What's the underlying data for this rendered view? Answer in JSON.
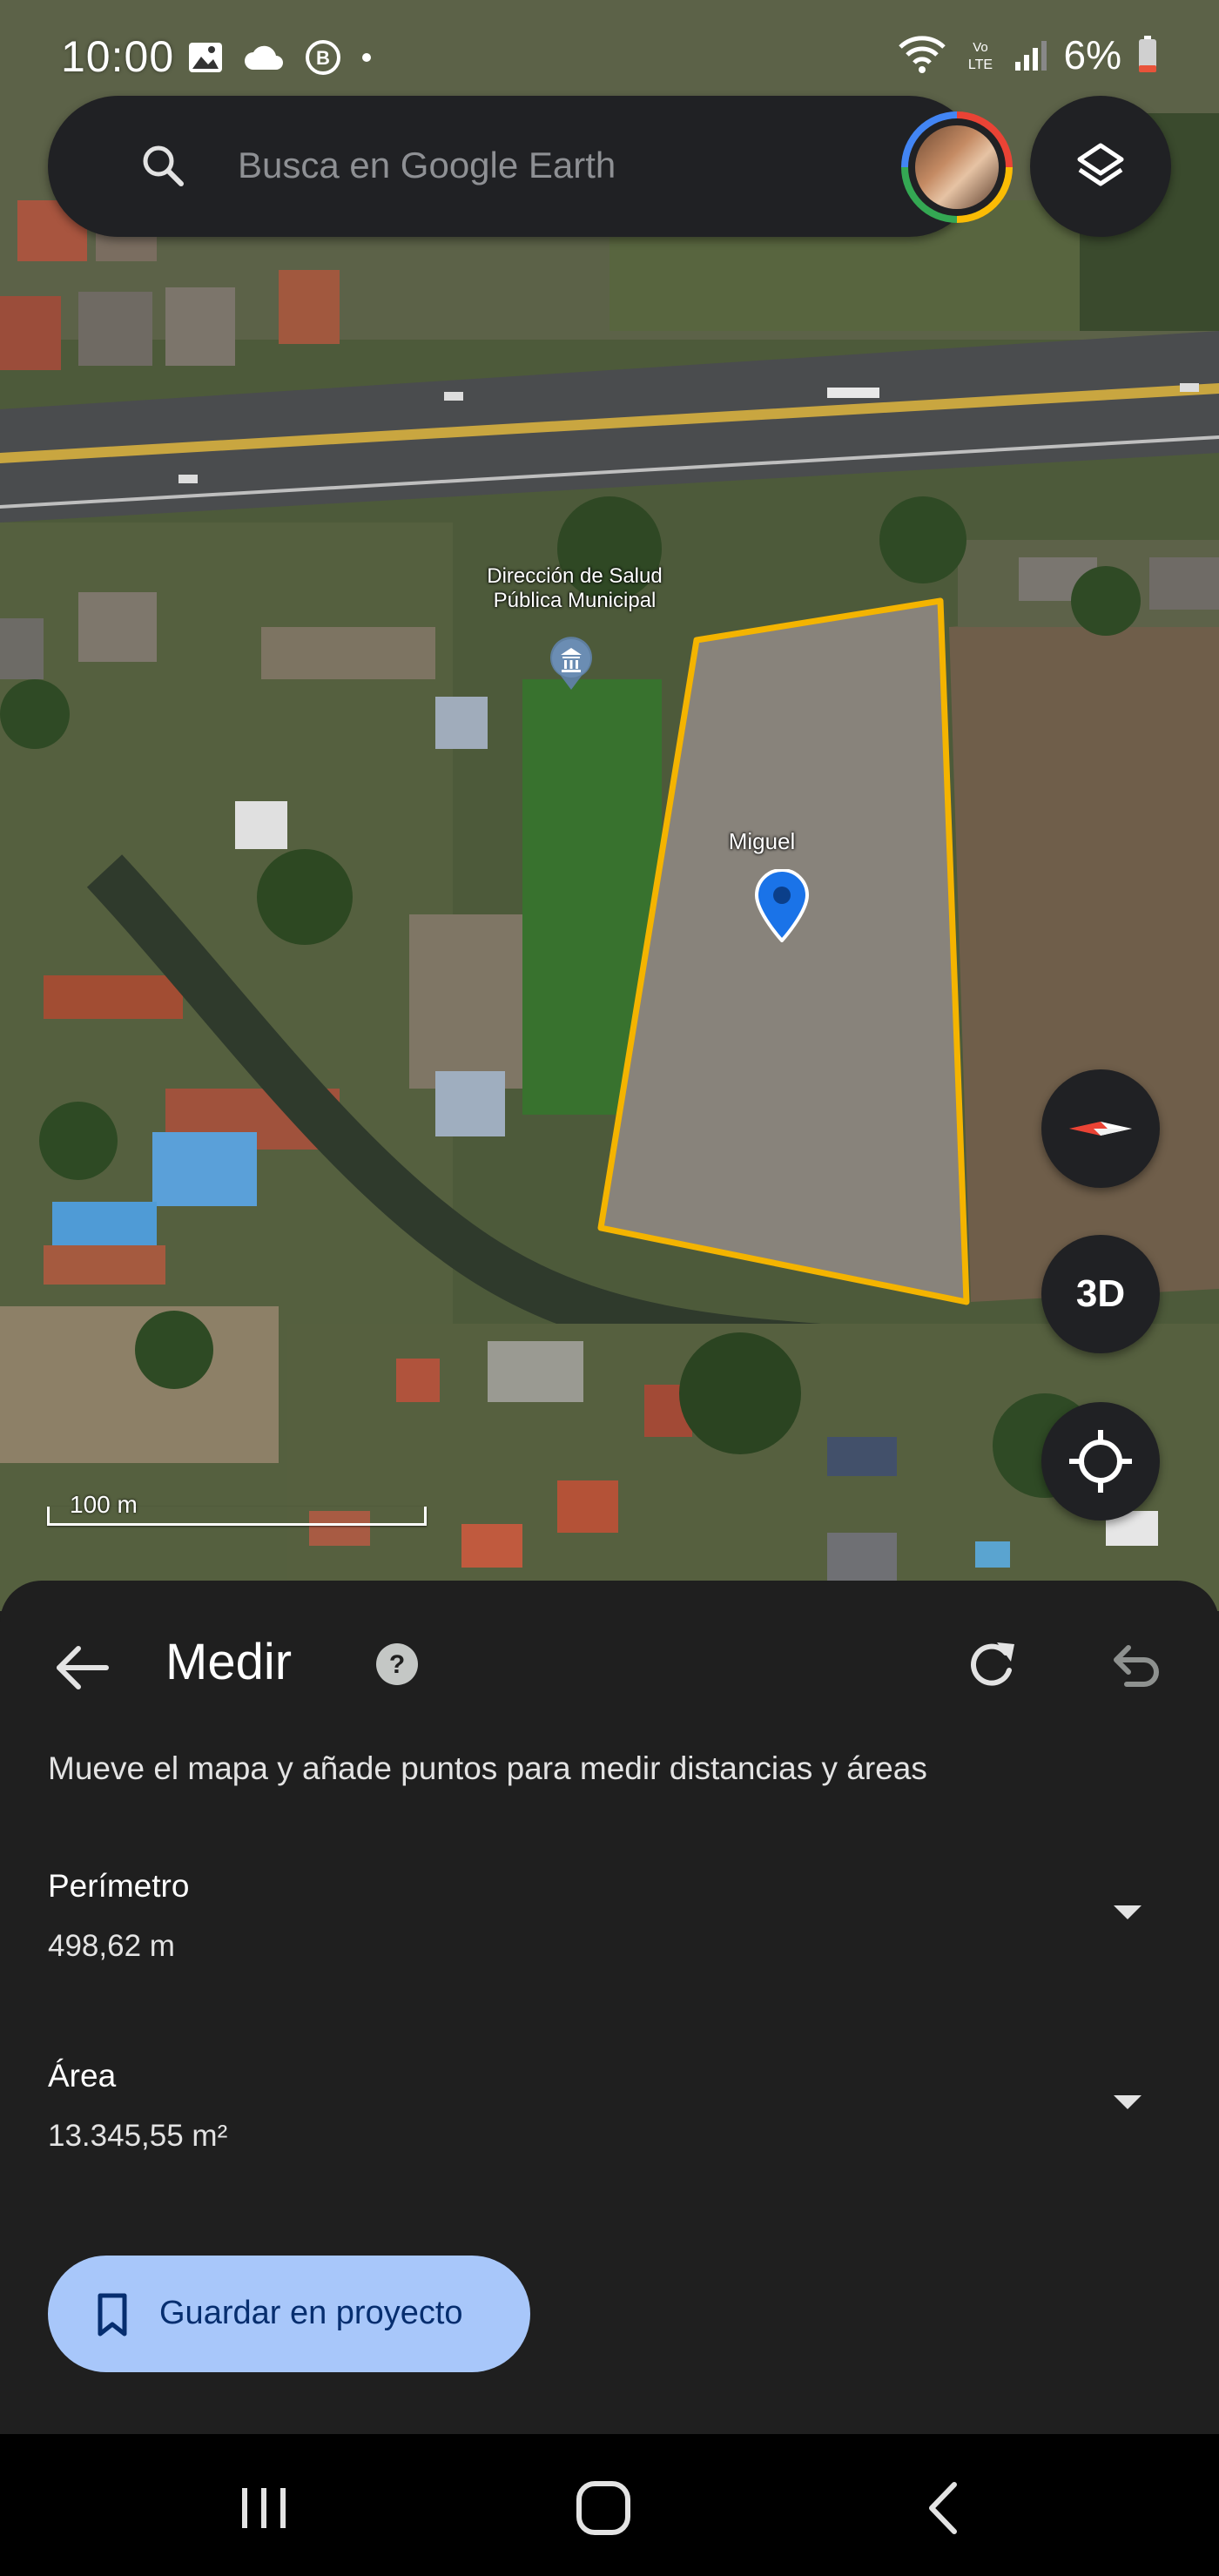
{
  "status_bar": {
    "time": "10:00",
    "battery": "6%",
    "icons": [
      "image-icon",
      "cloud-icon",
      "b-badge-icon",
      "dot-icon",
      "wifi-icon",
      "volte-icon",
      "signal-icon",
      "battery-icon"
    ]
  },
  "search": {
    "placeholder": "Busca en Google Earth"
  },
  "map": {
    "poi_label": "Dirección de Salud\nPública Municipal",
    "pin_label": "Miguel",
    "scale_label": "100 m",
    "polygon_color": "#f4b400",
    "pin_color": "#1a73e8",
    "controls": {
      "three_d_label": "3D"
    }
  },
  "sheet": {
    "title": "Medir",
    "instructions": "Mueve el mapa y añade puntos para medir distancias y áreas",
    "perimeter": {
      "label": "Perímetro",
      "value": "498,62 m"
    },
    "area": {
      "label": "Área",
      "value": "13.345,55 m²"
    },
    "save_button_label": "Guardar en proyecto"
  },
  "colors": {
    "sheet_bg": "#1f1f1f",
    "save_button_bg": "#a8c7fa",
    "save_button_text": "#062e6f"
  }
}
